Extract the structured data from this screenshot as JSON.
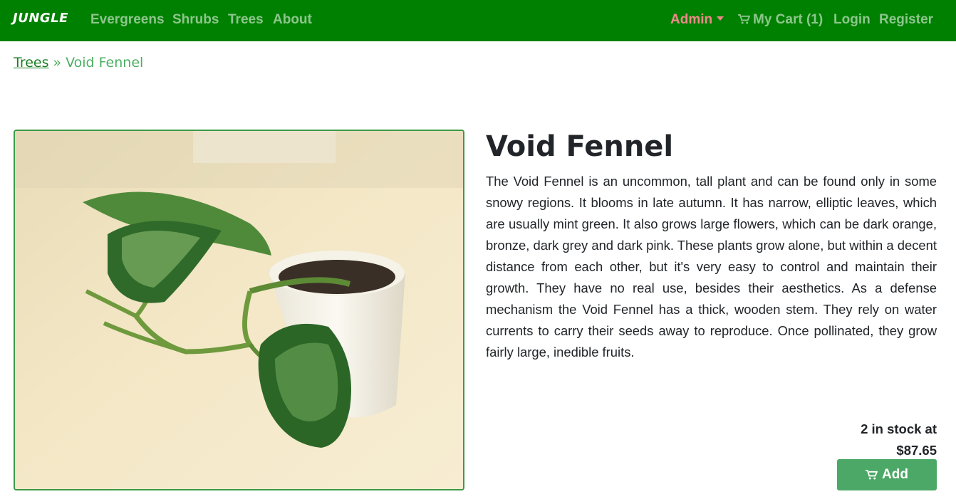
{
  "navbar": {
    "brand": "JUNGLE",
    "links": [
      "Evergreens",
      "Shrubs",
      "Trees",
      "About"
    ],
    "admin": "Admin",
    "cart": "My Cart (1)",
    "login": "Login",
    "register": "Register"
  },
  "breadcrumb": {
    "parent": "Trees",
    "separator": "»",
    "current": "Void Fennel"
  },
  "product": {
    "name": "Void Fennel",
    "description": "The Void Fennel is an uncommon, tall plant and can be found only in some snowy regions. It blooms in late autumn. It has narrow, elliptic leaves, which are usually mint green. It also grows large flowers, which can be dark orange, bronze, dark grey and dark pink. These plants grow alone, but within a decent distance from each other, but it's very easy to control and maintain their growth. They have no real use, besides their aesthetics. As a defense mechanism the Void Fennel has a thick, wooden stem. They rely on water currents to carry their seeds away to reproduce. Once pollinated, they grow fairly large, inedible fruits.",
    "stock_text": "2 in stock at",
    "price": "$87.65",
    "add_label": "Add"
  },
  "colors": {
    "navbar": "#008000",
    "admin": "#f08a8a",
    "button": "#4ca866",
    "breadcrumb": "#4caf62"
  },
  "icons": [
    "shopping-cart-icon",
    "chevron-down-icon"
  ]
}
